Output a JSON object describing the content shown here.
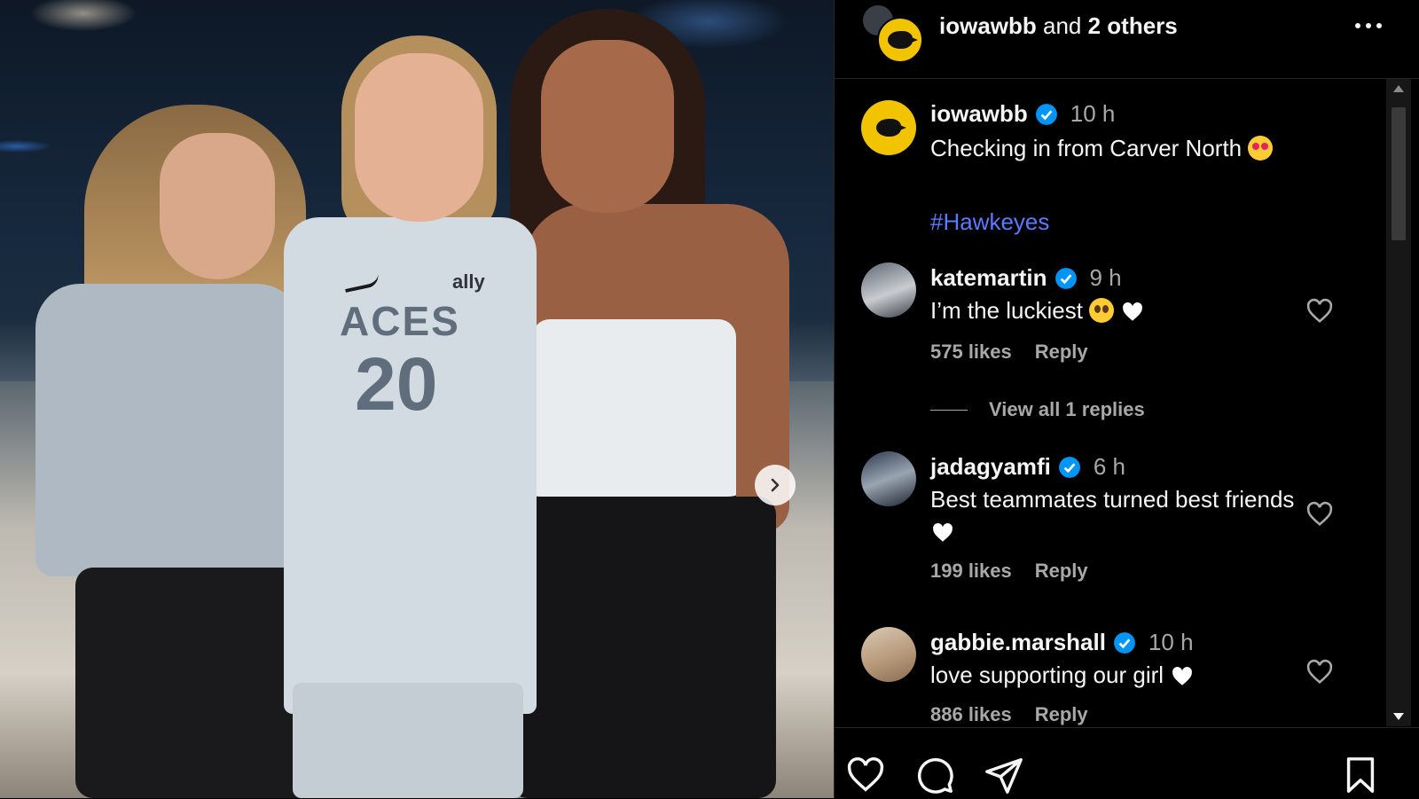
{
  "photo": {
    "jersey_brand": "ally",
    "jersey_team": "ACES",
    "jersey_number": "20",
    "next_label": "next-image"
  },
  "header": {
    "username": "iowawbb",
    "and_text": " and ",
    "others": "2 others"
  },
  "caption": {
    "username": "iowawbb",
    "time": "10 h",
    "text": "Checking in from Carver North",
    "hashtag": "#Hawkeyes"
  },
  "comments": [
    {
      "username": "katemartin",
      "time": "9 h",
      "text": "I’m the luckiest",
      "likes": "575 likes",
      "reply": "Reply",
      "view_replies": "View all 1 replies"
    },
    {
      "username": "jadagyamfi",
      "time": "6 h",
      "text": "Best teammates turned best friends",
      "likes": "199 likes",
      "reply": "Reply"
    },
    {
      "username": "gabbie.marshall",
      "time": "10 h",
      "text": "love supporting our girl",
      "likes": "886 likes",
      "reply": "Reply"
    }
  ],
  "colors": {
    "background": "#000000",
    "text": "#f5f5f5",
    "muted": "#a8a8a8",
    "link": "#5b7bff",
    "verified": "#0095f6",
    "iowa_gold": "#f2c400"
  },
  "icons": [
    "more-icon",
    "verified-icon",
    "heart-icon",
    "comment-icon",
    "share-icon",
    "bookmark-icon",
    "chevron-right-icon",
    "scroll-up-icon",
    "scroll-down-icon"
  ]
}
